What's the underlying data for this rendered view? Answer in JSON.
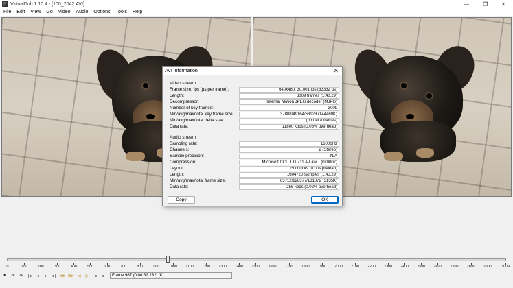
{
  "window": {
    "title": "VirtualDub 1.10.4 - [100_2042.AVI]",
    "minimize_glyph": "—",
    "maximize_glyph": "❐",
    "close_glyph": "✕"
  },
  "menu": [
    "File",
    "Edit",
    "View",
    "Go",
    "Video",
    "Audio",
    "Options",
    "Tools",
    "Help"
  ],
  "dialog": {
    "title": "AVI Information",
    "close_glyph": "✕",
    "video_section": "Video stream",
    "video_rows": [
      {
        "label": "Frame size, fps (µs per frame):",
        "value": "640x480, 30.001 fps (33332 µs)"
      },
      {
        "label": "Length:",
        "value": "3009 frames (1:40.29)"
      },
      {
        "label": "Decompressor:",
        "value": "Internal Motion JPEG decoder (MJPG)"
      },
      {
        "label": "Number of key frames:",
        "value": "3009"
      },
      {
        "label": "Min/avg/max/total key frame size:",
        "value": "37888/49164/63128 (144469K)"
      },
      {
        "label": "Min/avg/max/total delta size:",
        "value": "(no delta frames)"
      },
      {
        "label": "Data rate:",
        "value": "11800 kbps (0.05% overhead)"
      }
    ],
    "audio_section": "Audio stream",
    "audio_rows": [
      {
        "label": "Sampling rate:",
        "value": "16000Hz"
      },
      {
        "label": "Channels:",
        "value": "2 (Stereo)"
      },
      {
        "label": "Sample precision:",
        "value": "N/A"
      },
      {
        "label": "Compression:",
        "value": "Microsoft CCITT G.711 A-Law... (0x0007)"
      },
      {
        "label": "Layout:",
        "value": "25 chunks (0.00s preload)"
      },
      {
        "label": "Length:",
        "value": "1604720 samples (1:40.29)"
      },
      {
        "label": "Min/avg/max/total frame size:",
        "value": "63712/128377/131072 (3135K)"
      },
      {
        "label": "Data rate:",
        "value": "256 kbps (0.02% overhead)"
      }
    ],
    "copy_button": "Copy",
    "ok_button": "OK"
  },
  "timeline": {
    "ticks": [
      "0",
      "100",
      "200",
      "300",
      "400",
      "500",
      "600",
      "700",
      "800",
      "900",
      "1000",
      "1100",
      "1200",
      "1300",
      "1400",
      "1500",
      "1600",
      "1700",
      "1800",
      "1900",
      "2000",
      "2100",
      "2200",
      "2300",
      "2400",
      "2500",
      "2600",
      "2700",
      "2800",
      "2900",
      "3009"
    ],
    "total_frames": 3009,
    "current_frame": 967
  },
  "status": {
    "frame_text": "Frame 967 (0:00:32.232) [K]"
  },
  "toolbar_icons": [
    {
      "name": "stop-icon",
      "glyph": "■"
    },
    {
      "name": "play-input-icon",
      "glyph": "↷"
    },
    {
      "name": "play-output-icon",
      "glyph": "↷"
    },
    {
      "name": "start-icon",
      "glyph": "|◂"
    },
    {
      "name": "prev-frame-icon",
      "glyph": "◂"
    },
    {
      "name": "next-frame-icon",
      "glyph": "▸"
    },
    {
      "name": "end-icon",
      "glyph": "▸|"
    },
    {
      "name": "prev-key-icon",
      "glyph": "⋘"
    },
    {
      "name": "next-key-icon",
      "glyph": "⋙"
    },
    {
      "name": "prev-scene-icon",
      "glyph": "◁"
    },
    {
      "name": "next-scene-icon",
      "glyph": "▷"
    },
    {
      "name": "mark-in-icon",
      "glyph": "◂"
    },
    {
      "name": "mark-out-icon",
      "glyph": "▸"
    }
  ]
}
